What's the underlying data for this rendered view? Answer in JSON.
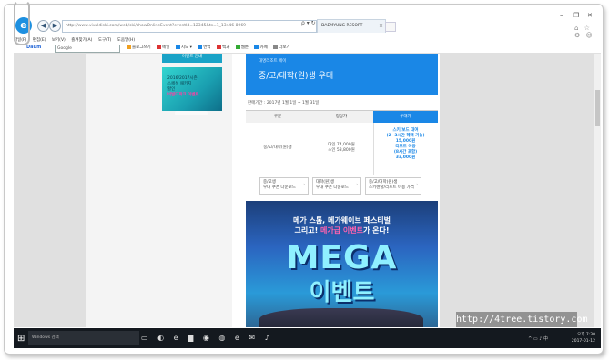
{
  "browser": {
    "address": "http://www.vivaldiski.com/web/ski/showOnlineEvent?eventId=12345&ts=1_13446 8969",
    "tab_title": "DAEMYUNG RESORT",
    "tab_close": "×",
    "address_icons": "ρ ▾ ↻",
    "win_min": "–",
    "win_max": "❐",
    "win_close": "✕",
    "fav_icons": "⌂ ☆ ⚙ ☺"
  },
  "menubar": {
    "items": [
      "파일(F)",
      "편집(E)",
      "보기(V)",
      "즐겨찾기(A)",
      "도구(T)",
      "도움말(H)"
    ]
  },
  "favorites_bar": {
    "daum": "Daum",
    "search_placeholder": "Google",
    "items": [
      {
        "label": "블로그쓰기",
        "color": "#f0a020"
      },
      {
        "label": "메일",
        "color": "#d33"
      },
      {
        "label": "지도 ▾",
        "color": "#1a87e6"
      },
      {
        "label": "번역",
        "color": "#1a87e6"
      },
      {
        "label": "백과",
        "color": "#d33"
      },
      {
        "label": "웹툰",
        "color": "#3a3"
      },
      {
        "label": "카페",
        "color": "#1a87e6"
      },
      {
        "label": "더보기",
        "color": "#888"
      }
    ]
  },
  "sidebar": {
    "promo1": "이벤트 안내",
    "promo2_lines": [
      "2016/2017시즌",
      "스페셜 패키지",
      "할인"
    ],
    "promo2_highlight": "비발디파크 이벤트"
  },
  "page": {
    "banner_sub": "대명리조트 페이",
    "banner_title": "중/고/대학(원)생 우대",
    "period": "판매기간 : 2017년 1월 1일 ~ 1월 31일",
    "price_table": {
      "headers": [
        "구분",
        "정상가",
        "우대가"
      ],
      "row_label": "중/고/대학(원)생",
      "normal_lines": [
        "대인 74,000원",
        "소인 58,800원"
      ],
      "special_lines": [
        "스키/보드 대여",
        "(2~3시간 혜택 가능)",
        "15,000원",
        "",
        "리프트 이용",
        "(8시간 포함)",
        "33,000원"
      ]
    },
    "links": [
      {
        "title": "중/고생",
        "sub": "우대 쿠폰 다운로드"
      },
      {
        "title": "대학(원)생",
        "sub": "우대 쿠폰 다운로드"
      },
      {
        "title": "중/고/대학(원)생",
        "sub": "스키렌탈/리프트 이용 가격"
      }
    ],
    "poster": {
      "line1": "메가 스톰, 메가웨이브 페스티벌",
      "line2_prefix": "그리고! ",
      "line2_highlight": "메가급 이벤트",
      "line2_suffix": "가 온다!",
      "mega": "MEGA",
      "event": "이벤트"
    }
  },
  "taskbar": {
    "start": "⊞",
    "search": "Windows 검색",
    "icons": [
      "▭",
      "◐",
      "e",
      "▆",
      "◉",
      "◍",
      "e",
      "✉",
      "♪"
    ],
    "tray_icons": "^ ▭ ♪ 中",
    "time": "오후 7:30",
    "date": "2017-01-12"
  },
  "watermark": "http://4tree.tistory.com"
}
